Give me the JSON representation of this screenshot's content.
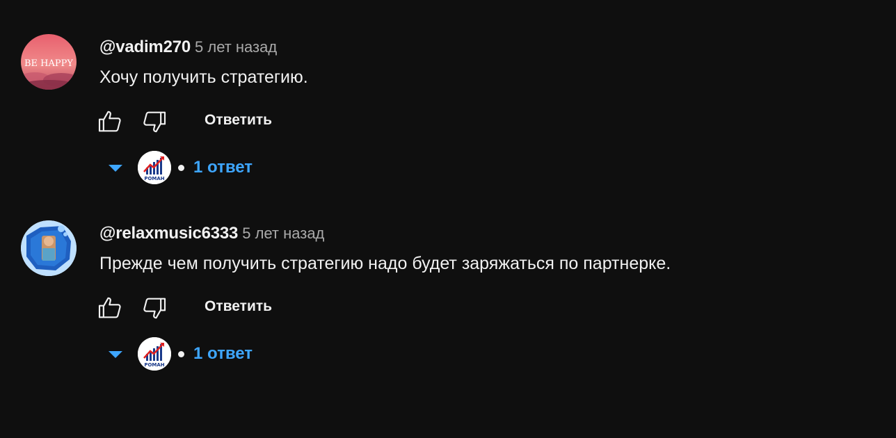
{
  "comments": [
    {
      "author": "@vadim270",
      "time": "5 лет назад",
      "text": "Хочу получить стратегию.",
      "avatar_text": "BE HAPPY",
      "reply_label": "Ответить",
      "replies": {
        "count_label": "1 ответ",
        "reply_avatar_text": "РОМАН"
      }
    },
    {
      "author": "@relaxmusic6333",
      "time": "5 лет назад",
      "text": "Прежде чем получить стратегию надо будет заряжаться по партнерке.",
      "reply_label": "Ответить",
      "replies": {
        "count_label": "1 ответ",
        "reply_avatar_text": "РОМАН"
      }
    }
  ],
  "colors": {
    "background": "#0f0f0f",
    "text": "#f1f1f1",
    "secondary": "#aaaaaa",
    "link": "#3ea6ff"
  }
}
